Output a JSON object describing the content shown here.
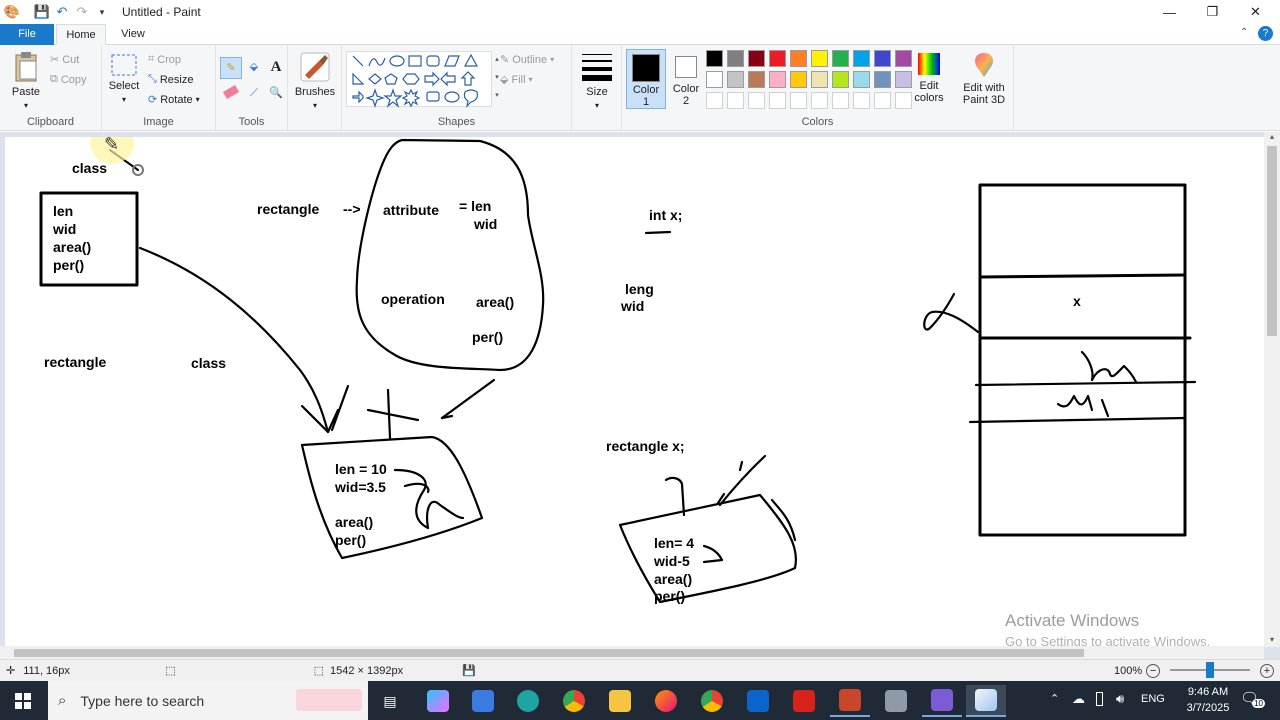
{
  "window": {
    "title": "Untitled - Paint"
  },
  "tabs": [
    {
      "label": "File"
    },
    {
      "label": "Home"
    },
    {
      "label": "View"
    }
  ],
  "ribbon": {
    "clipboard": {
      "label": "Clipboard",
      "paste": "Paste",
      "cut": "Cut",
      "copy": "Copy"
    },
    "image": {
      "label": "Image",
      "select": "Select",
      "crop": "Crop",
      "resize": "Resize",
      "rotate": "Rotate"
    },
    "tools": {
      "label": "Tools"
    },
    "brushes": {
      "label": "Brushes"
    },
    "shapes": {
      "label": "Shapes",
      "outline": "Outline",
      "fill": "Fill"
    },
    "size": {
      "label": "Size"
    },
    "color1": {
      "label": "Color 1"
    },
    "color2": {
      "label": "Color 2"
    },
    "colors": {
      "label": "Colors",
      "edit_colors": "Edit colors"
    },
    "paint3d": {
      "label": "Edit with Paint 3D"
    }
  },
  "palette": {
    "row1": [
      "#000000",
      "#7f7f7f",
      "#880015",
      "#ed1c24",
      "#ff7f27",
      "#fff200",
      "#22b14c",
      "#00a2e8",
      "#3f48cc",
      "#a349a4"
    ],
    "row2": [
      "#ffffff",
      "#c3c3c3",
      "#b97a57",
      "#ffaec9",
      "#ffc90e",
      "#efe4b0",
      "#b5e61d",
      "#99d9ea",
      "#7092be",
      "#c8bfe7"
    ],
    "color1": "#000000",
    "color2": "#ffffff"
  },
  "canvas_text": {
    "class1": "class",
    "len": "len",
    "wid": "wid",
    "area": "area()",
    "per": "per()",
    "rectangle1": "rectangle",
    "arrow": "-->",
    "attribute": "attribute",
    "eq_len": "= len",
    "wid2": "wid",
    "operation": "operation",
    "area2": "area()",
    "per2": "per()",
    "rectangle2": "rectangle",
    "class2": "class",
    "intx": "int x;",
    "leng": "leng",
    "wid3": "wid",
    "obj1_len": "len = 10",
    "obj1_wid": "wid=3.5",
    "obj1_area": "area()",
    "obj1_per": "per()",
    "rectx": "rectangle x;",
    "obj2_len": "len= 4",
    "obj2_wid": "wid-5",
    "obj2_area": "area()",
    "obj2_per": "per()",
    "x": "x"
  },
  "watermark": {
    "title": "Activate Windows",
    "subtitle": "Go to Settings to activate Windows."
  },
  "status": {
    "cursor": "111, 16px",
    "size": "1542 × 1392px",
    "zoom": "100%"
  },
  "taskbar": {
    "search_placeholder": "Type here to search",
    "lang": "ENG",
    "time": "9:46 AM",
    "date": "3/7/2025",
    "notif": "10"
  }
}
